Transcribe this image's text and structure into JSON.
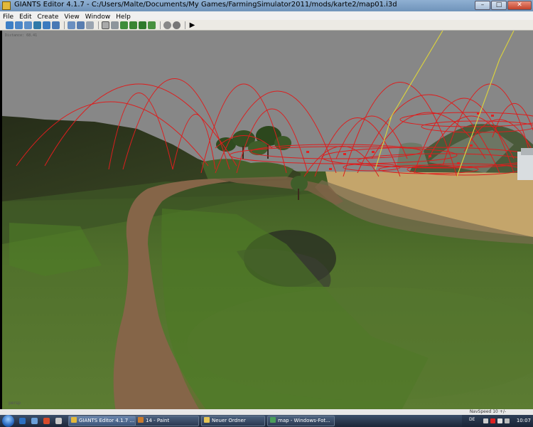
{
  "window": {
    "title": "GIANTS Editor 4.1.7 - C:/Users/Malte/Documents/My Games/FarmingSimulator2011/mods/karte2/map01.i3d",
    "minimize": "–",
    "maximize": "□",
    "close": "✕"
  },
  "menu": [
    "File",
    "Edit",
    "Create",
    "View",
    "Window",
    "Help"
  ],
  "viewport": {
    "distance": "Distance: 68.41",
    "camera": "persp"
  },
  "status": {
    "navspeed": "NavSpeed 10 +/-"
  },
  "taskbar": {
    "tasks": [
      {
        "label": "GIANTS Editor 4.1.7 ..."
      },
      {
        "label": "14 - Paint"
      },
      {
        "label": "Neuer Ordner"
      },
      {
        "label": "map - Windows-Fot..."
      }
    ],
    "language": "DE",
    "clock": "10:07"
  },
  "colors": {
    "sky": "#878787",
    "grass": "#4e6e26",
    "path": "#8a6a4c",
    "field": "#c9ad75",
    "light_radius": "#e02020",
    "spot_light": "#d8d040"
  }
}
